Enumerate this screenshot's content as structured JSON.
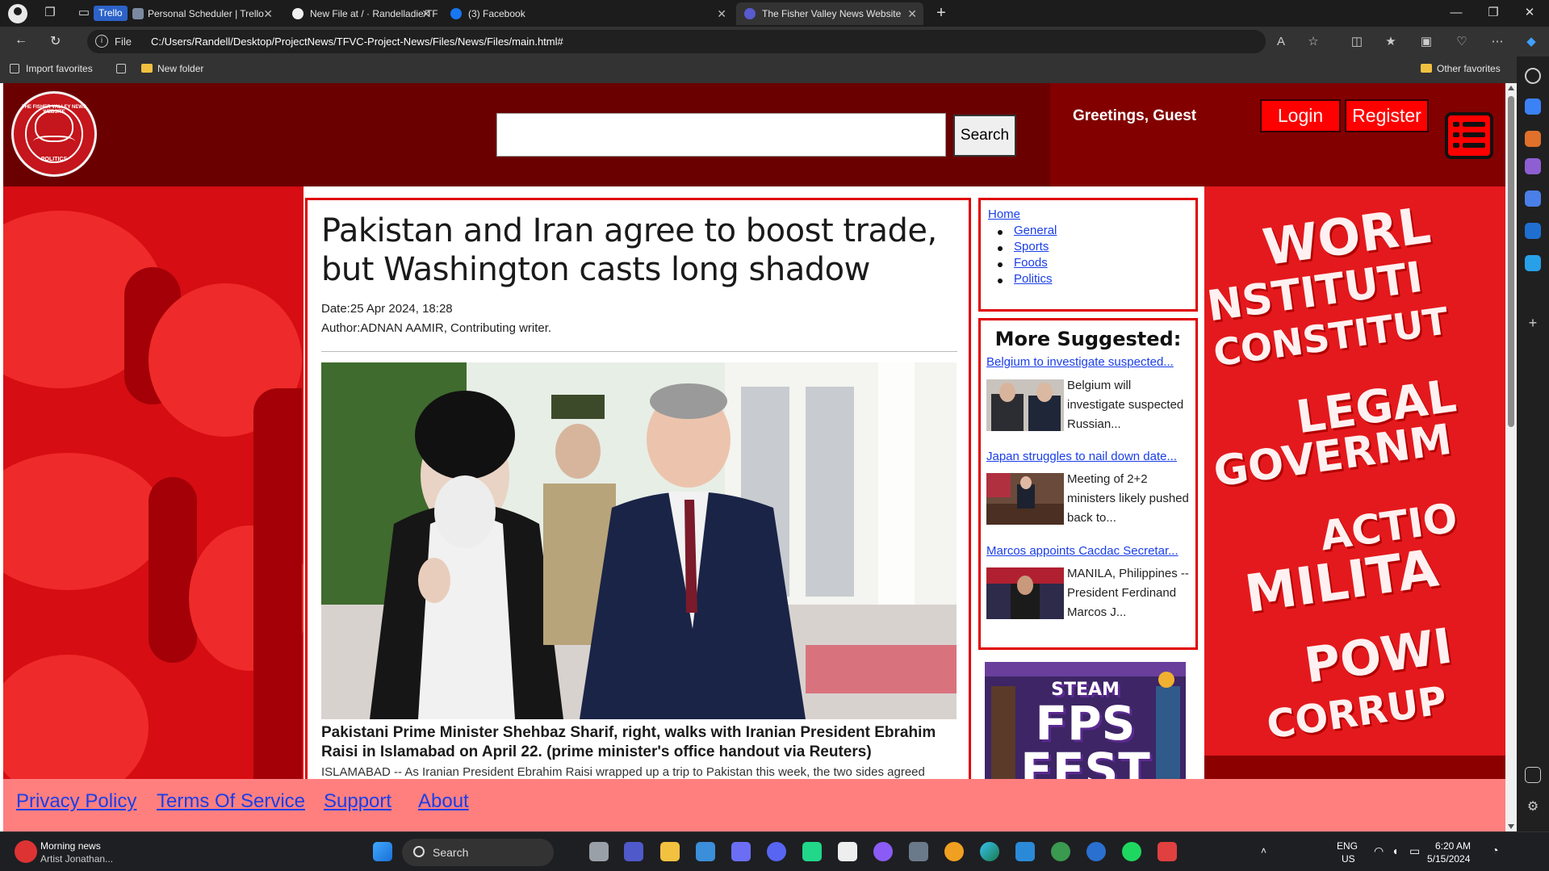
{
  "browser": {
    "tabs": [
      {
        "label": "Personal Scheduler | Trello",
        "badge": "Trello"
      },
      {
        "label": "New File at / · Randelladie/TFVC"
      },
      {
        "label": "(3) Facebook"
      },
      {
        "label": "The Fisher Valley News Website"
      }
    ],
    "address": {
      "protocol": "File",
      "url": "C:/Users/Randell/Desktop/ProjectNews/TFVC-Project-News/Files/News/Files/main.html#"
    },
    "favorites": {
      "import": "Import favorites",
      "new_folder": "New folder",
      "other": "Other favorites"
    }
  },
  "site": {
    "logo": {
      "top_text": "THE FISHER VALLEY NEWS WEBSITE",
      "bottom_text": "POLITICS"
    },
    "search_button": "Search",
    "greeting": "Greetings, Guest",
    "login": "Login",
    "register": "Register",
    "nav": [
      "Home",
      "General",
      "Sports",
      "Foods",
      "Politics"
    ],
    "article": {
      "title": "Pakistan and Iran agree to boost trade, but Washington casts long shadow",
      "date": "Date:25 Apr 2024, 18:28",
      "author": "Author:ADNAN AAMIR, Contributing writer.",
      "caption": "Pakistani Prime Minister Shehbaz Sharif, right, walks with Iranian President Ebrahim Raisi in Islamabad on April 22. (prime minister's office handout via Reuters)",
      "body": "ISLAMABAD -- As Iranian President Ebrahim Raisi wrapped up a trip to Pakistan this week, the two sides agreed"
    },
    "suggested": {
      "heading": "More Suggested:",
      "items": [
        {
          "link": "Belgium to investigate suspected...",
          "desc": "Belgium will investigate suspected Russian..."
        },
        {
          "link": "Japan struggles to nail down date...",
          "desc": "Meeting of 2+2 ministers likely pushed back to..."
        },
        {
          "link": "Marcos appoints Cacdac Secretar...",
          "desc": "MANILA, Philippines -- President Ferdinand Marcos J..."
        }
      ]
    },
    "ad": {
      "line1": "STEAM",
      "line2": "FPS",
      "line3": "FEST"
    },
    "bg_words": [
      "WORL",
      "NSTITUTI",
      "CONSTITUT",
      "LEGAL",
      "GOVERNM",
      "ACTIO",
      "MILITA",
      "POWI",
      "CORRUP"
    ],
    "footer": [
      "Privacy Policy",
      "Terms Of Service",
      "Support",
      "About"
    ]
  },
  "taskbar": {
    "news_title": "Morning news",
    "news_sub": "Artist Jonathan...",
    "search": "Search",
    "lang1": "ENG",
    "lang2": "US",
    "time": "6:20 AM",
    "date": "5/15/2024"
  }
}
